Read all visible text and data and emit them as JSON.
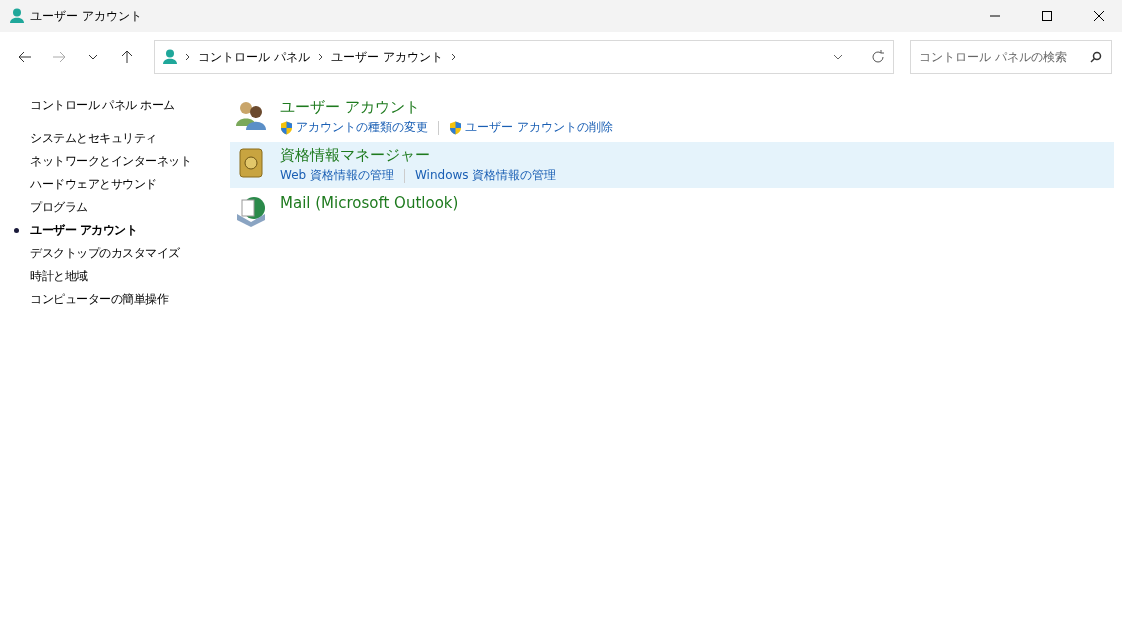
{
  "window": {
    "title": "ユーザー アカウント"
  },
  "address_bar": {
    "breadcrumbs": [
      "コントロール パネル",
      "ユーザー アカウント"
    ]
  },
  "search": {
    "placeholder": "コントロール パネルの検索"
  },
  "sidebar": {
    "home": "コントロール パネル ホーム",
    "items": [
      {
        "label": "システムとセキュリティ",
        "selected": false
      },
      {
        "label": "ネットワークとインターネット",
        "selected": false
      },
      {
        "label": "ハードウェアとサウンド",
        "selected": false
      },
      {
        "label": "プログラム",
        "selected": false
      },
      {
        "label": "ユーザー アカウント",
        "selected": true
      },
      {
        "label": "デスクトップのカスタマイズ",
        "selected": false
      },
      {
        "label": "時計と地域",
        "selected": false
      },
      {
        "label": "コンピューターの簡単操作",
        "selected": false
      }
    ]
  },
  "categories": [
    {
      "kind": "users",
      "title": "ユーザー アカウント",
      "selected": false,
      "links": [
        {
          "label": "アカウントの種類の変更",
          "kind": "admin"
        },
        {
          "label": "ユーザー アカウントの削除",
          "kind": "admin"
        }
      ]
    },
    {
      "kind": "vault",
      "title": "資格情報マネージャー",
      "selected": true,
      "links": [
        {
          "label": "Web 資格情報の管理",
          "kind": "plain"
        },
        {
          "label": "Windows 資格情報の管理",
          "kind": "plain"
        }
      ]
    },
    {
      "kind": "mail",
      "title": "Mail (Microsoft Outlook)",
      "selected": false
    }
  ]
}
